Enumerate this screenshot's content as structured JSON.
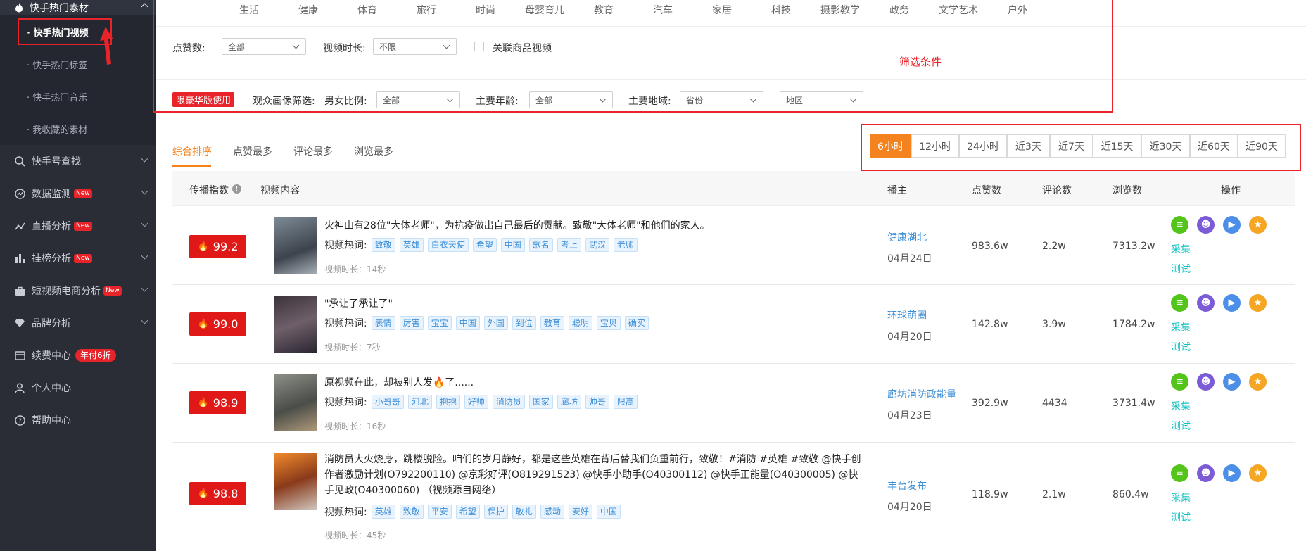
{
  "sidebar": {
    "section": "快手热门素材",
    "subs": [
      "· 快手热门视频",
      "· 快手热门标签",
      "· 快手热门音乐",
      "· 我收藏的素材"
    ],
    "items": [
      {
        "label": "快手号查找",
        "icon": "search-icon"
      },
      {
        "label": "数据监测",
        "icon": "monitor-icon",
        "badge": "New"
      },
      {
        "label": "直播分析",
        "icon": "line-chart-icon",
        "badge": "New"
      },
      {
        "label": "挂榜分析",
        "icon": "bar-chart-icon",
        "badge": "New"
      },
      {
        "label": "短视频电商分析",
        "icon": "bag-icon",
        "badge": "New"
      },
      {
        "label": "品牌分析",
        "icon": "diamond-icon"
      },
      {
        "label": "续费中心",
        "icon": "card-icon",
        "badge": "年付6折"
      },
      {
        "label": "个人中心",
        "icon": "user-icon"
      },
      {
        "label": "帮助中心",
        "icon": "help-icon"
      }
    ]
  },
  "categories": [
    "生活",
    "健康",
    "体育",
    "旅行",
    "时尚",
    "母婴育儿",
    "教育",
    "汽车",
    "家居",
    "科技",
    "摄影教学",
    "政务",
    "文学艺术",
    "户外"
  ],
  "filters": {
    "likes_label": "点赞数:",
    "likes_value": "全部",
    "duration_label": "视频时长:",
    "duration_value": "不限",
    "product_label": "关联商品视频",
    "note": "筛选条件",
    "vip_tag": "限豪华版使用",
    "audience_label": "观众画像筛选:",
    "gender_label": "男女比例:",
    "gender_value": "全部",
    "age_label": "主要年龄:",
    "age_value": "全部",
    "region_label": "主要地域:",
    "province_value": "省份",
    "area_value": "地区"
  },
  "sort_tabs": [
    "综合排序",
    "点赞最多",
    "评论最多",
    "浏览最多"
  ],
  "time_ranges": [
    "6小时",
    "12小时",
    "24小时",
    "近3天",
    "近7天",
    "近15天",
    "近30天",
    "近60天",
    "近90天"
  ],
  "table": {
    "headers": [
      "传播指数",
      "视频内容",
      "播主",
      "点赞数",
      "评论数",
      "浏览数",
      "操作"
    ],
    "kw_label": "视频热词:",
    "op_collect": "采集",
    "op_test": "测试",
    "rows": [
      {
        "heat": "99.2",
        "title": "火神山有28位\"大体老师\"，为抗疫做出自己最后的贡献。致敬\"大体老师\"和他们的家人。",
        "tags": [
          "致敬",
          "英雄",
          "白衣天使",
          "希望",
          "中国",
          "歌名",
          "考上",
          "武汉",
          "老师"
        ],
        "duration": "视频时长：14秒",
        "owner": "健康湖北",
        "date": "04月24日",
        "likes": "983.6w",
        "comments": "2.2w",
        "views": "7313.2w"
      },
      {
        "heat": "99.0",
        "title": "\"承让了承让了\"",
        "tags": [
          "表情",
          "厉害",
          "宝宝",
          "中国",
          "外国",
          "到位",
          "教育",
          "聪明",
          "宝贝",
          "确实"
        ],
        "duration": "视频时长：7秒",
        "owner": "环球萌圈",
        "date": "04月20日",
        "likes": "142.8w",
        "comments": "3.9w",
        "views": "1784.2w"
      },
      {
        "heat": "98.9",
        "title": "原视频在此，却被别人发🔥了......",
        "tags": [
          "小哥哥",
          "河北",
          "抱抱",
          "好帅",
          "消防员",
          "国家",
          "廊坊",
          "帅哥",
          "限高"
        ],
        "duration": "视频时长：16秒",
        "owner": "廊坊消防政能量",
        "date": "04月23日",
        "likes": "392.9w",
        "comments": "4434",
        "views": "3731.4w"
      },
      {
        "heat": "98.8",
        "title": "消防员大火烧身，跳楼脱险。咱们的岁月静好，都是这些英雄在背后替我们负重前行，致敬！#消防 #英雄 #致敬 @快手创作者激励计划(O792200110) @京彩好评(O819291523) @快手小助手(O40300112) @快手正能量(O40300005) @快手见政(O40300060) （视频源自网络）",
        "tags": [
          "英雄",
          "致敬",
          "平安",
          "希望",
          "保护",
          "敬礼",
          "感动",
          "安好",
          "中国"
        ],
        "duration": "视频时长：45秒",
        "owner": "丰台发布",
        "date": "04月20日",
        "likes": "118.9w",
        "comments": "2.1w",
        "views": "860.4w"
      }
    ]
  }
}
